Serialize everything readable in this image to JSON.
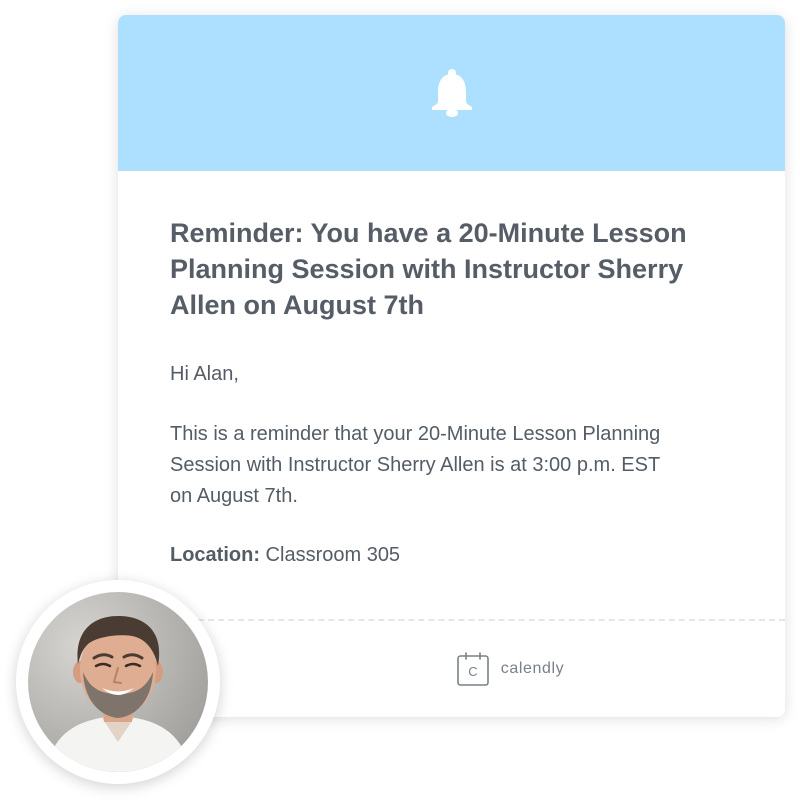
{
  "header": {
    "icon": "bell-icon",
    "background": "#ade0ff"
  },
  "reminder": {
    "title": "Reminder: You have a 20-Minute Lesson Planning Session with Instructor Sherry Allen on August 7th",
    "greeting": "Hi Alan,",
    "message": "This is a reminder that your 20-Minute Lesson Planning Session with Instructor Sherry Allen is at 3:00 p.m. EST on August 7th.",
    "location_label": "Location:",
    "location_value": " Classroom 305"
  },
  "footer": {
    "icon": "calendar-icon",
    "icon_letter": "C",
    "brand": "calendly"
  },
  "avatar": {
    "icon": "person-photo"
  }
}
